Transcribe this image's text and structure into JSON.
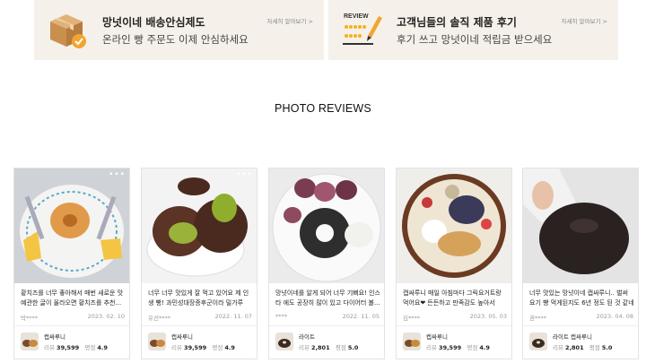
{
  "banners": [
    {
      "title": "망넛이네 배송안심제도",
      "subtitle": "온라인 빵 주문도 이제 안심하세요",
      "more": "자세히 알아보기 >",
      "icon": "delivery-box-icon"
    },
    {
      "title": "고객님들의 솔직 제품 후기",
      "subtitle": "후기 쓰고 망넛이네 적립금 받으세요",
      "more": "자세히 알아보기 >",
      "icon": "review-pencil-icon",
      "icon_text": "REVIEW"
    }
  ],
  "section_title": "PHOTO REVIEWS",
  "reviews": [
    {
      "text": "황치즈를 너무 좋아해서 매번 새로운 맛 예관한 글이 올라오면 황치즈를 추천...",
      "author": "박****",
      "date": "2023. 02. 10",
      "product": "캡싸루니",
      "review_label": "리뷰",
      "review_count": "39,599",
      "rating_label": "평점",
      "rating": "4.9"
    },
    {
      "text": "너무 너무 맛있게 잘 먹고 있어요 제 인생 빵! 과민성대장증후군이라 밀가루 먹...",
      "author": "유선****",
      "date": "2022. 11. 07",
      "product": "캡싸루니",
      "review_label": "리뷰",
      "review_count": "39,599",
      "rating_label": "평점",
      "rating": "4.9"
    },
    {
      "text": "망넛이네를 알게 되어 너무 기뻐요! 인스타 에도 공장히 많이 있고 다이어터 볼...",
      "author": "****",
      "date": "2022. 11. 05",
      "product": "라이트",
      "review_label": "리뷰",
      "review_count": "2,801",
      "rating_label": "평점",
      "rating": "5.0"
    },
    {
      "text": "캡싸루니 매일 아침마다 그릭요거트랑 먹어요❤ 든든하고 만족감도 높아서 식...",
      "author": "김****",
      "date": "2023. 05. 03",
      "product": "캡싸루니",
      "review_label": "리뷰",
      "review_count": "39,599",
      "rating_label": "평점",
      "rating": "4.9"
    },
    {
      "text": "너무 맛있는 망넛이네 캡싸루니.. 벌써 요기 빵 먹게된지도 6년 정도 된 것 같네요.",
      "author": "권****",
      "date": "2023. 04. 08",
      "product": "라이트 캡싸루니",
      "review_label": "리뷰",
      "review_count": "2,801",
      "rating_label": "평점",
      "rating": "5.0"
    }
  ],
  "colors": {
    "banner_bg": "#f5f1ea",
    "accent": "#f2a531",
    "star": "#f5b21a"
  }
}
